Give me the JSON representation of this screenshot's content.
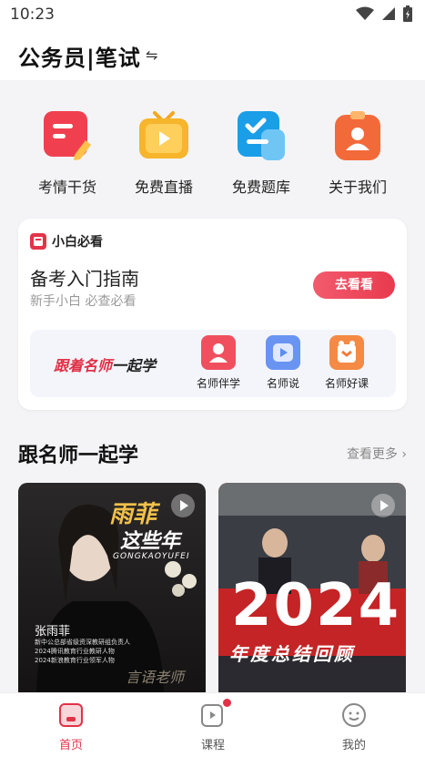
{
  "status_bar": {
    "time": "10:23"
  },
  "header": {
    "title": "公务员|笔试",
    "swap_glyph": "⇋"
  },
  "quick_links": [
    {
      "label": "考情干货",
      "icon": "notes-pencil-icon",
      "color": "#f0404f"
    },
    {
      "label": "免费直播",
      "icon": "tv-play-icon",
      "color": "#f5a623"
    },
    {
      "label": "免费题库",
      "icon": "checklist-icon",
      "color": "#1a9ee8"
    },
    {
      "label": "关于我们",
      "icon": "person-badge-icon",
      "color": "#f26a3a"
    }
  ],
  "guide_card": {
    "tag": "小白必看",
    "title": "备考入门指南",
    "subtitle": "新手小白 必查必看",
    "button": "去看看",
    "slogan_red": "跟着名师",
    "slogan_dark": "一起学",
    "mini_items": [
      {
        "label": "名师伴学",
        "icon": "teacher-icon",
        "color": "#f0505e"
      },
      {
        "label": "名师说",
        "icon": "video-play-icon",
        "color": "#5b8cf0"
      },
      {
        "label": "名师好课",
        "icon": "course-icon",
        "color": "#f07a3a"
      }
    ]
  },
  "section": {
    "title": "跟名师一起学",
    "more": "查看更多 ›"
  },
  "videos": [
    {
      "headline": "雨菲",
      "headline2": "这些年",
      "banner": "GONGKAOYUFEI",
      "name": "张雨菲",
      "lines": [
        "新中公总部省级资深教研组负责人",
        "2024腾讯教育行业教研人物",
        "2024新浪教育行业领军人物"
      ],
      "overlay": "言语老师"
    },
    {
      "big": "2024",
      "caption": "年度总结回顾"
    }
  ],
  "tabs": [
    {
      "label": "首页",
      "icon": "home-icon",
      "active": true
    },
    {
      "label": "课程",
      "icon": "course-play-icon",
      "badge": true
    },
    {
      "label": "我的",
      "icon": "smile-profile-icon"
    }
  ],
  "colors": {
    "accent": "#e23248"
  }
}
